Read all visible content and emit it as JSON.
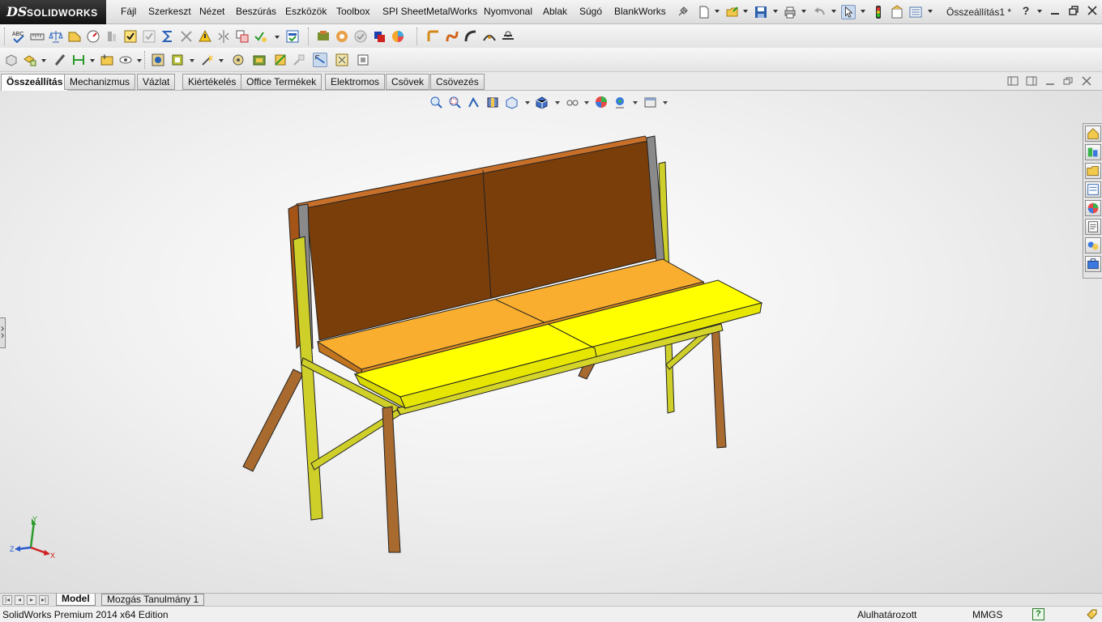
{
  "app": {
    "logo_prefix": "DS",
    "logo_name": "SOLIDWORKS",
    "document_title": "Összeállítás1 *",
    "help_glyph": "?"
  },
  "menu": [
    {
      "label": "Fájl"
    },
    {
      "label": "Szerkeszt"
    },
    {
      "label": "Nézet"
    },
    {
      "label": "Beszúrás"
    },
    {
      "label": "Eszközök"
    },
    {
      "label": "Toolbox"
    },
    {
      "label": "SPI SheetMetalWorks"
    },
    {
      "label": "Nyomvonal"
    },
    {
      "label": "Ablak"
    },
    {
      "label": "Súgó"
    },
    {
      "label": "BlankWorks"
    }
  ],
  "command_tabs": [
    {
      "label": "Összeállítás",
      "active": true
    },
    {
      "label": "Mechanizmus",
      "active": false
    },
    {
      "label": "Vázlat",
      "active": false
    },
    {
      "label": "Kiértékelés",
      "active": false
    },
    {
      "label": "Office Termékek",
      "active": false
    },
    {
      "label": "Elektromos",
      "active": false
    },
    {
      "label": "Csövek",
      "active": false
    },
    {
      "label": "Csövezés",
      "active": false
    }
  ],
  "toolbar1_icons": [
    "spell-check-icon",
    "measure-icon",
    "mass-properties-icon",
    "section-properties-icon",
    "interference-detection-icon",
    "clearance-icon",
    "check-icon",
    "tolerance-icon",
    "sum-icon",
    "hole-alignment-icon",
    "warning-icon",
    "symmetry-icon",
    "compare-icon",
    "validate-icon",
    "design-checker-icon",
    "import-diagnostics-icon",
    "deviation-icon",
    "thickness-icon",
    "curvature-icon",
    "color-icon",
    "render-icon",
    "fillet-icon",
    "bend-icon",
    "sweep-icon",
    "route-icon",
    "flow-icon"
  ],
  "toolbar2_icons": [
    "insert-component-icon",
    "mate-icon",
    "linear-pattern-icon",
    "smart-fasteners-icon",
    "move-component-icon",
    "show-hidden-icon",
    "assembly-features-icon",
    "reference-geometry-icon",
    "new-motion-icon",
    "bill-of-materials-icon",
    "exploded-view-icon",
    "explode-line-icon",
    "interference-icon",
    "toggle-icon",
    "instant3d-icon"
  ],
  "heads_up_icons": [
    "zoom-to-fit-icon",
    "zoom-area-icon",
    "previous-view-icon",
    "section-view-icon",
    "view-orientation-icon",
    "display-style-icon",
    "hide-show-icon",
    "edit-appearance-icon",
    "apply-scene-icon",
    "view-settings-icon"
  ],
  "task_pane_icons": [
    "home-icon",
    "design-library-icon",
    "file-explorer-icon",
    "view-palette-icon",
    "appearances-icon",
    "custom-properties-icon",
    "forum-icon",
    "toolbox-icon"
  ],
  "triad": {
    "x_label": "X",
    "y_label": "Y",
    "z_label": "Z"
  },
  "bottom_tabs": [
    {
      "label": "Model",
      "active": true
    },
    {
      "label": "Mozgás Tanulmány 1",
      "active": false
    }
  ],
  "status": {
    "edition": "SolidWorks Premium 2014 x64 Edition",
    "definition": "Alulhatározott",
    "units": "MMGS",
    "help": "?"
  },
  "colors": {
    "backrest": "#7a3e0b",
    "seat_cushion": "#f9ae2f",
    "seat_front": "#ffff00",
    "frame": "#d4d42a",
    "leg": "#a0622a"
  }
}
